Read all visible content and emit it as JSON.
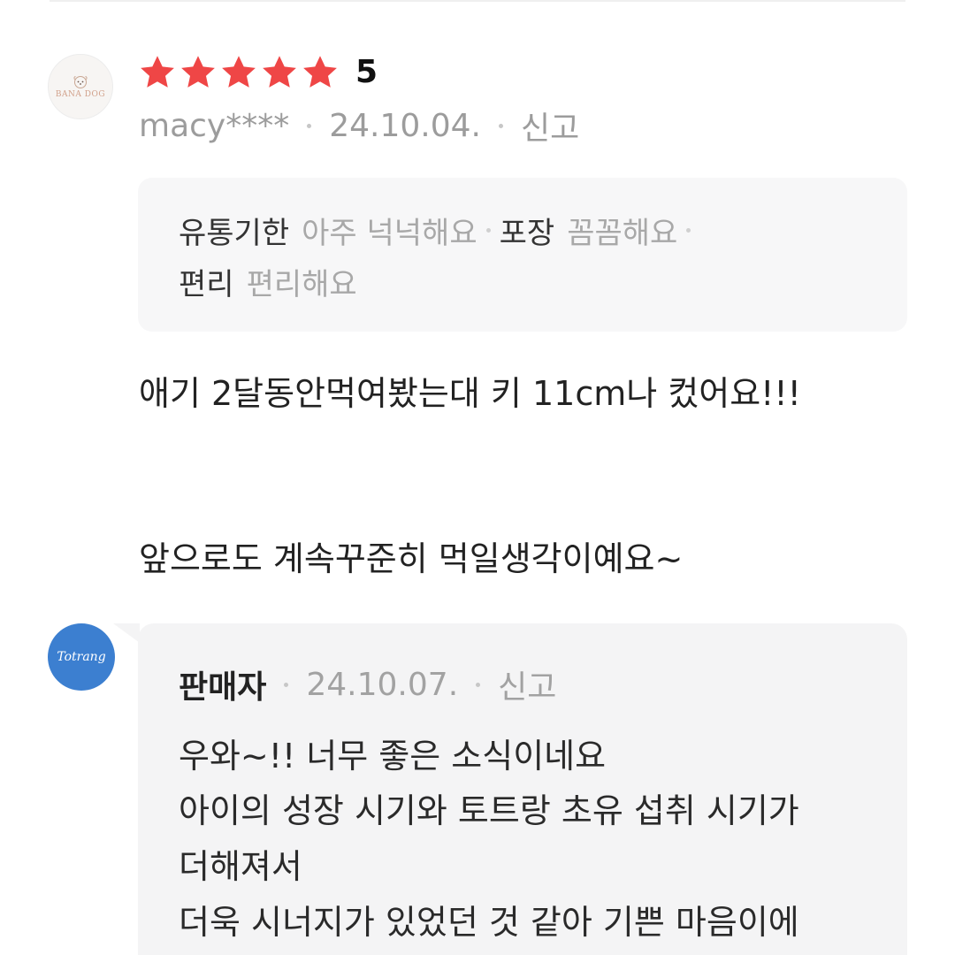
{
  "review": {
    "avatar": {
      "icon": "brand-logo-avatar",
      "text": "BANA DOG"
    },
    "rating": {
      "stars_filled": 5,
      "stars_total": 5,
      "value": "5",
      "star_color": "#ef4646"
    },
    "author": "macy****",
    "date": "24.10.04.",
    "report_label": "신고",
    "tags": [
      {
        "key": "유통기한",
        "value": "아주 넉넉해요"
      },
      {
        "key": "포장",
        "value": "꼼꼼해요"
      },
      {
        "key": "편리",
        "value": "편리해요"
      }
    ],
    "body_lines": [
      "애기 2달동안먹여봤는대 키 11cm나 컸어요!!!",
      "앞으로도 계속꾸준히 먹일생각이예요~"
    ]
  },
  "reply": {
    "avatar_text": "Totrang",
    "avatar_color": "#3c7fd0",
    "seller_label": "판매자",
    "date": "24.10.07.",
    "report_label": "신고",
    "body_lines": [
      "우와~!! 너무 좋은 소식이네요",
      "아이의 성장 시기와 토트랑 초유 섭취 시기가",
      "더해져서",
      "더욱 시너지가 있었던 것 같아 기쁜 마음이에"
    ]
  }
}
